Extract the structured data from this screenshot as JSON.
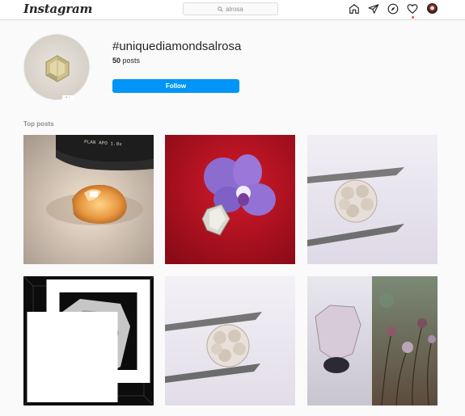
{
  "topbar": {
    "logo": "Instagram",
    "search_value": "alrosa",
    "nav_icons": [
      "home-icon",
      "direct-icon",
      "explore-icon",
      "activity-heart-icon",
      "profile-avatar"
    ]
  },
  "profile": {
    "hashtag": "#uniquediamondsalrosa",
    "posts_count": "50",
    "posts_label": "posts",
    "follow_label": "Follow"
  },
  "top_posts": {
    "label": "Top posts",
    "posts": [
      {
        "subject": "orange diamond under microscope",
        "overlay_text": "PLAN APO 1.0x"
      },
      {
        "subject": "rough diamond with purple orchid"
      },
      {
        "subject": "carved diamond held in tweezers"
      },
      {
        "subject": "grey diamond scan render",
        "multi": true
      },
      {
        "subject": "carved diamond held in tweezers"
      },
      {
        "subject": "pink diamond with dried flowers"
      }
    ]
  },
  "colors": {
    "accent": "#0095f6",
    "notification": "#ed4956",
    "text": "#262626",
    "muted": "#8e8e8e"
  }
}
